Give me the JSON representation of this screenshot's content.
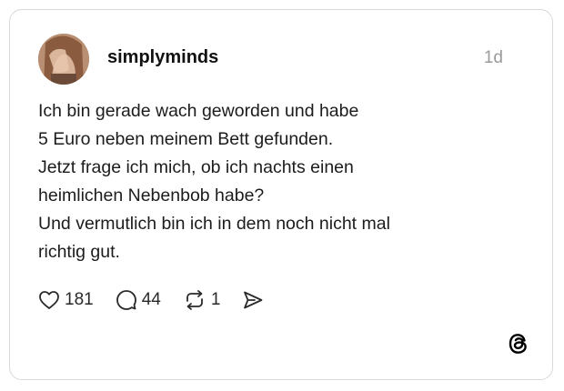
{
  "post": {
    "username": "simplyminds",
    "timestamp": "1d",
    "avatar_icon": "user-photo-avatar",
    "text_lines": [
      "Ich bin gerade wach geworden und habe",
      "5 Euro neben meinem Bett gefunden.",
      "Jetzt frage ich mich, ob ich nachts einen",
      "heimlichen Nebenbob habe?",
      "Und vermutlich bin ich in dem noch nicht mal",
      "richtig gut."
    ]
  },
  "actions": {
    "like": {
      "icon": "heart-icon",
      "count": "181"
    },
    "reply": {
      "icon": "comment-icon",
      "count": "44"
    },
    "repost": {
      "icon": "repost-icon",
      "count": "1"
    },
    "share": {
      "icon": "send-icon"
    }
  },
  "branding": {
    "icon": "threads-logo-icon"
  },
  "colors": {
    "border": "#d9d9d9",
    "text": "#1c1c1c",
    "muted": "#9a9a9a"
  }
}
